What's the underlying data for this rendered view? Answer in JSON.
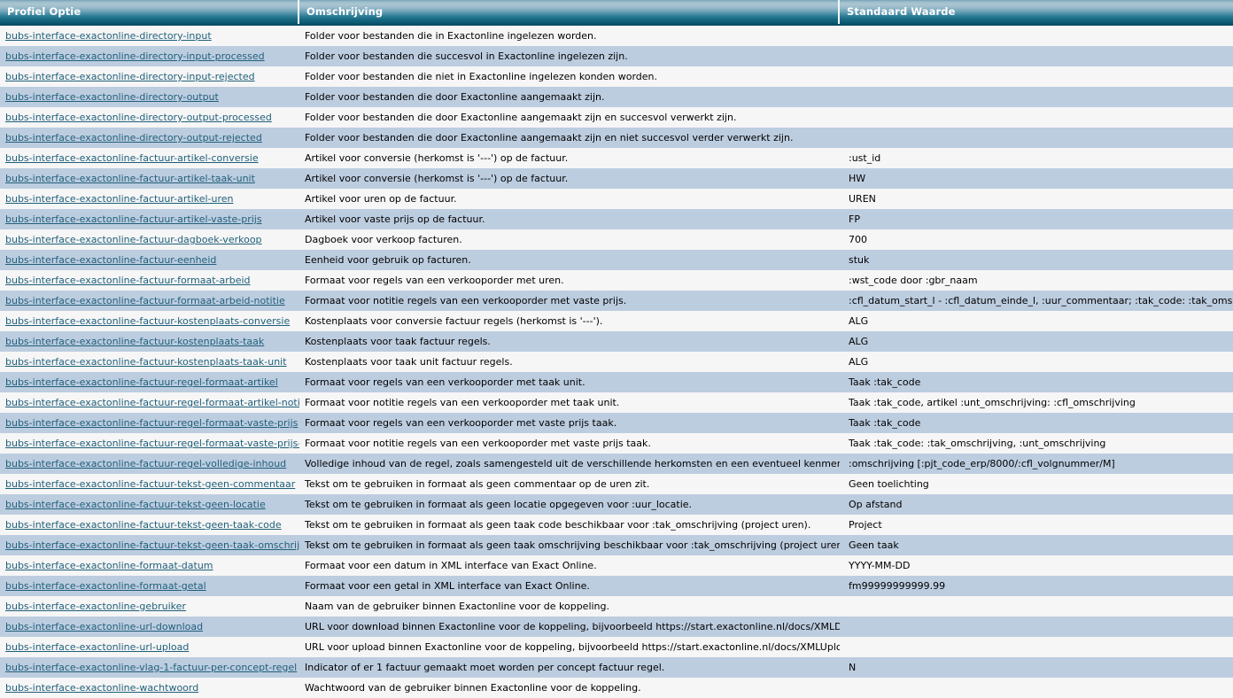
{
  "table": {
    "columns": [
      {
        "key": "option",
        "label": "Profiel Optie"
      },
      {
        "key": "description",
        "label": "Omschrijving"
      },
      {
        "key": "value",
        "label": "Standaard Waarde"
      }
    ],
    "colors": {
      "header_gradient_top": "#a9c6d2",
      "header_gradient_bottom": "#0a5068",
      "header_text": "#ffffff",
      "row_even_bg": "#f6f6f6",
      "row_odd_bg": "#bdcde0",
      "link_text": "#1f5f7a",
      "body_text": "#000000"
    },
    "rows": [
      {
        "option": "bubs-interface-exactonline-directory-input",
        "description": "Folder voor bestanden die in Exactonline ingelezen worden.",
        "value": ""
      },
      {
        "option": "bubs-interface-exactonline-directory-input-processed",
        "description": "Folder voor bestanden die succesvol in Exactonline ingelezen zijn.",
        "value": ""
      },
      {
        "option": "bubs-interface-exactonline-directory-input-rejected",
        "description": "Folder voor bestanden die niet in Exactonline ingelezen konden worden.",
        "value": ""
      },
      {
        "option": "bubs-interface-exactonline-directory-output",
        "description": "Folder voor bestanden die door Exactonline aangemaakt zijn.",
        "value": ""
      },
      {
        "option": "bubs-interface-exactonline-directory-output-processed",
        "description": "Folder voor bestanden die door Exactonline aangemaakt zijn en succesvol verwerkt zijn.",
        "value": ""
      },
      {
        "option": "bubs-interface-exactonline-directory-output-rejected",
        "description": "Folder voor bestanden die door Exactonline aangemaakt zijn en niet succesvol verder verwerkt zijn.",
        "value": ""
      },
      {
        "option": "bubs-interface-exactonline-factuur-artikel-conversie",
        "description": "Artikel voor conversie (herkomst is '---') op de factuur.",
        "value": ":ust_id"
      },
      {
        "option": "bubs-interface-exactonline-factuur-artikel-taak-unit",
        "description": "Artikel voor conversie (herkomst is '---') op de factuur.",
        "value": "HW"
      },
      {
        "option": "bubs-interface-exactonline-factuur-artikel-uren",
        "description": "Artikel voor uren op de factuur.",
        "value": "UREN"
      },
      {
        "option": "bubs-interface-exactonline-factuur-artikel-vaste-prijs",
        "description": "Artikel voor vaste prijs op de factuur.",
        "value": "FP"
      },
      {
        "option": "bubs-interface-exactonline-factuur-dagboek-verkoop",
        "description": "Dagboek voor verkoop facturen.",
        "value": "700"
      },
      {
        "option": "bubs-interface-exactonline-factuur-eenheid",
        "description": "Eenheid voor gebruik op facturen.",
        "value": "stuk"
      },
      {
        "option": "bubs-interface-exactonline-factuur-formaat-arbeid",
        "description": "Formaat voor regels van een verkooporder met uren.",
        "value": ":wst_code door :gbr_naam"
      },
      {
        "option": "bubs-interface-exactonline-factuur-formaat-arbeid-notitie",
        "description": "Formaat voor notitie regels van een verkooporder met vaste prijs.",
        "value": ":cfl_datum_start_l - :cfl_datum_einde_l, :uur_commentaar; :tak_code: :tak_omschrijving"
      },
      {
        "option": "bubs-interface-exactonline-factuur-kostenplaats-conversie",
        "description": "Kostenplaats voor conversie factuur regels (herkomst is '---').",
        "value": "ALG"
      },
      {
        "option": "bubs-interface-exactonline-factuur-kostenplaats-taak",
        "description": "Kostenplaats voor taak factuur regels.",
        "value": "ALG"
      },
      {
        "option": "bubs-interface-exactonline-factuur-kostenplaats-taak-unit",
        "description": "Kostenplaats voor taak unit factuur regels.",
        "value": "ALG"
      },
      {
        "option": "bubs-interface-exactonline-factuur-regel-formaat-artikel",
        "description": "Formaat voor regels van een verkooporder met taak unit.",
        "value": "Taak :tak_code"
      },
      {
        "option": "bubs-interface-exactonline-factuur-regel-formaat-artikel-notitie",
        "description": "Formaat voor notitie regels van een verkooporder met taak unit.",
        "value": "Taak :tak_code, artikel :unt_omschrijving: :cfl_omschrijving"
      },
      {
        "option": "bubs-interface-exactonline-factuur-regel-formaat-vaste-prijs",
        "description": "Formaat voor regels van een verkooporder met vaste prijs taak.",
        "value": "Taak :tak_code"
      },
      {
        "option": "bubs-interface-exactonline-factuur-regel-formaat-vaste-prijs-notitie",
        "description": "Formaat voor notitie regels van een verkooporder met vaste prijs taak.",
        "value": "Taak :tak_code: :tak_omschrijving, :unt_omschrijving"
      },
      {
        "option": "bubs-interface-exactonline-factuur-regel-volledige-inhoud",
        "description": "Volledige inhoud van de regel, zoals samengesteld uit de verschillende herkomsten en een eventueel kenmerk.",
        "value": ":omschrijving [:pjt_code_erp/8000/:cfl_volgnummer/M]"
      },
      {
        "option": "bubs-interface-exactonline-factuur-tekst-geen-commentaar",
        "description": "Tekst om te gebruiken in formaat als geen commentaar op de uren zit.",
        "value": "Geen toelichting"
      },
      {
        "option": "bubs-interface-exactonline-factuur-tekst-geen-locatie",
        "description": "Tekst om te gebruiken in formaat als geen locatie opgegeven voor :uur_locatie.",
        "value": "Op afstand"
      },
      {
        "option": "bubs-interface-exactonline-factuur-tekst-geen-taak-code",
        "description": "Tekst om te gebruiken in formaat als geen taak code beschikbaar voor :tak_omschrijving (project uren).",
        "value": "Project"
      },
      {
        "option": "bubs-interface-exactonline-factuur-tekst-geen-taak-omschrijving",
        "description": "Tekst om te gebruiken in formaat als geen taak omschrijving beschikbaar voor :tak_omschrijving (project uren).",
        "value": "Geen taak"
      },
      {
        "option": "bubs-interface-exactonline-formaat-datum",
        "description": "Formaat voor een datum in XML interface van Exact Online.",
        "value": "YYYY-MM-DD"
      },
      {
        "option": "bubs-interface-exactonline-formaat-getal",
        "description": "Formaat voor een getal in XML interface van Exact Online.",
        "value": "fm99999999999.99"
      },
      {
        "option": "bubs-interface-exactonline-gebruiker",
        "description": "Naam van de gebruiker binnen Exactonline voor de koppeling.",
        "value": ""
      },
      {
        "option": "bubs-interface-exactonline-url-download",
        "description": "URL voor download binnen Exactonline voor de koppeling, bijvoorbeeld https://start.exactonline.nl/docs/XMLDownload.aspx.",
        "value": ""
      },
      {
        "option": "bubs-interface-exactonline-url-upload",
        "description": "URL voor upload binnen Exactonline voor de koppeling, bijvoorbeeld https://start.exactonline.nl/docs/XMLUpload.aspx.",
        "value": ""
      },
      {
        "option": "bubs-interface-exactonline-vlag-1-factuur-per-concept-regel",
        "description": "Indicator of er 1 factuur gemaakt moet worden per concept factuur regel.",
        "value": "N"
      },
      {
        "option": "bubs-interface-exactonline-wachtwoord",
        "description": "Wachtwoord van de gebruiker binnen Exactonline voor de koppeling.",
        "value": ""
      }
    ]
  }
}
